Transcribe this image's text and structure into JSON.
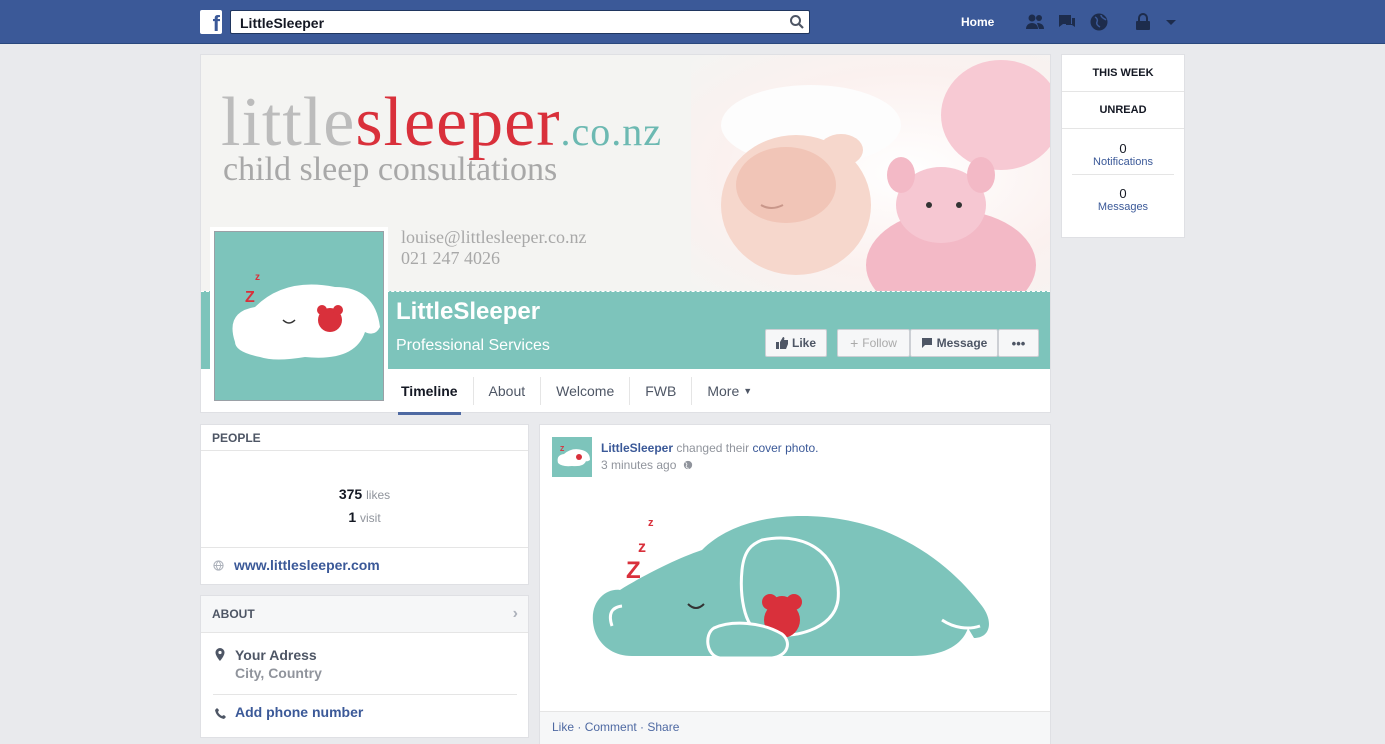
{
  "topbar": {
    "search_value": "LittleSleeper",
    "home_label": "Home"
  },
  "cover": {
    "logo_little": "little",
    "logo_sleeper": "sleeper",
    "logo_tld": ".co.nz",
    "tagline": "child sleep consultations",
    "email": "louise@littlesleeper.co.nz",
    "phone": "021 247 4026"
  },
  "page": {
    "name": "LittleSleeper",
    "category": "Professional Services",
    "buttons": {
      "like": "Like",
      "follow": "Follow",
      "message": "Message",
      "more": "•••"
    },
    "tabs": [
      "Timeline",
      "About",
      "Welcome",
      "FWB",
      "More"
    ]
  },
  "sidebar": {
    "this_week": "THIS WEEK",
    "unread": "UNREAD",
    "notifications_count": "0",
    "notifications_label": "Notifications",
    "messages_count": "0",
    "messages_label": "Messages"
  },
  "people": {
    "heading": "PEOPLE",
    "likes_count": "375",
    "likes_label": "likes",
    "visits_count": "1",
    "visits_label": "visit",
    "website": "www.littlesleeper.com"
  },
  "about": {
    "heading": "ABOUT",
    "address_line1": "Your Adress",
    "address_line2": "City, Country",
    "phone_cta": "Add phone number"
  },
  "post": {
    "author": "LittleSleeper",
    "action": "changed their",
    "object": "cover photo.",
    "time": "3 minutes ago",
    "like": "Like",
    "comment": "Comment",
    "share": "Share"
  },
  "colors": {
    "facebook_blue": "#3b5998",
    "brand_teal": "#7dc4bb",
    "brand_red": "#d9303b"
  }
}
